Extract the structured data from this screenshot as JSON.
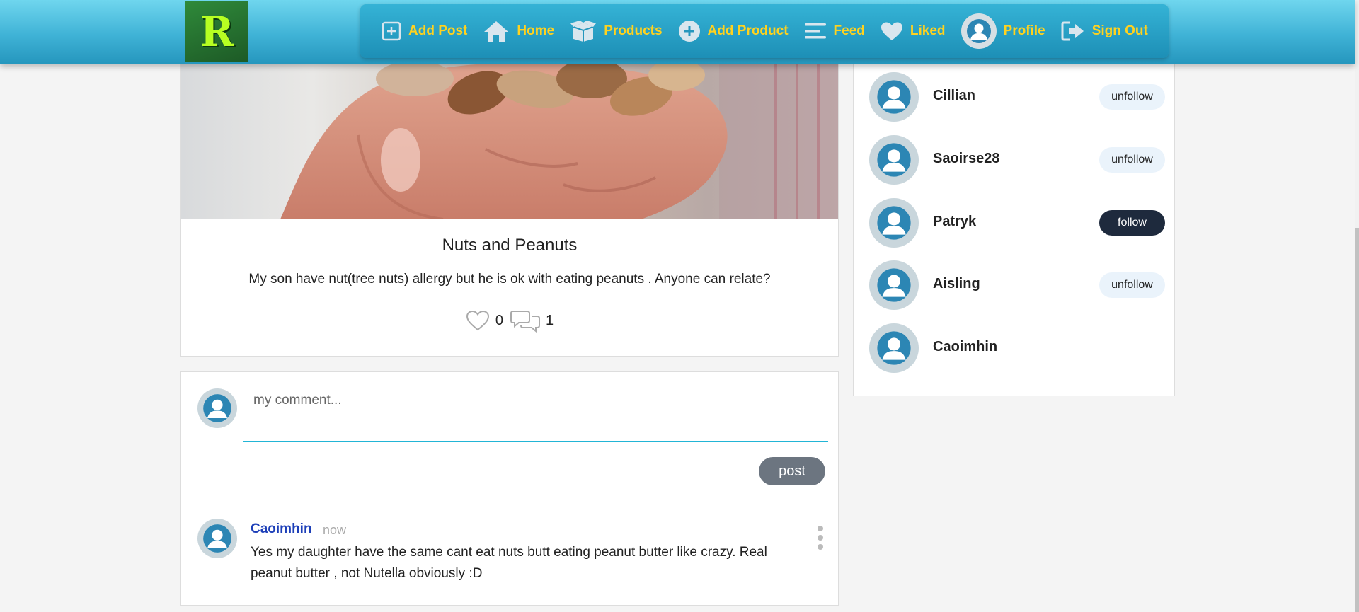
{
  "nav": {
    "logo_letter": "R",
    "items": [
      {
        "label": "Add Post",
        "icon": "plus-square-icon"
      },
      {
        "label": "Home",
        "icon": "home-icon"
      },
      {
        "label": "Products",
        "icon": "box-icon"
      },
      {
        "label": "Add Product",
        "icon": "plus-circle-icon"
      },
      {
        "label": "Feed",
        "icon": "menu-lines-icon"
      },
      {
        "label": "Liked",
        "icon": "heart-icon"
      },
      {
        "label": "Profile",
        "icon": "avatar-icon"
      },
      {
        "label": "Sign Out",
        "icon": "sign-out-icon"
      }
    ],
    "text_color": "#ffd21f"
  },
  "post": {
    "title": "Nuts and Peanuts",
    "body": "My son have nut(tree nuts) allergy but he is ok with eating peanuts . Anyone can relate?",
    "likes": "0",
    "comments": "1"
  },
  "comment_form": {
    "placeholder": "my comment...",
    "value": "",
    "submit_label": "post"
  },
  "comments": [
    {
      "user": "Caoimhin",
      "time": "now",
      "text": "Yes my daughter have the same cant eat nuts butt eating peanut butter like crazy. Real peanut butter , not Nutella obviously :D"
    }
  ],
  "following": [
    {
      "name": "Cillian",
      "action": "unfollow"
    },
    {
      "name": "Saoirse28",
      "action": "unfollow"
    },
    {
      "name": "Patryk",
      "action": "follow"
    },
    {
      "name": "Aisling",
      "action": "unfollow"
    },
    {
      "name": "Caoimhin",
      "action": ""
    }
  ]
}
